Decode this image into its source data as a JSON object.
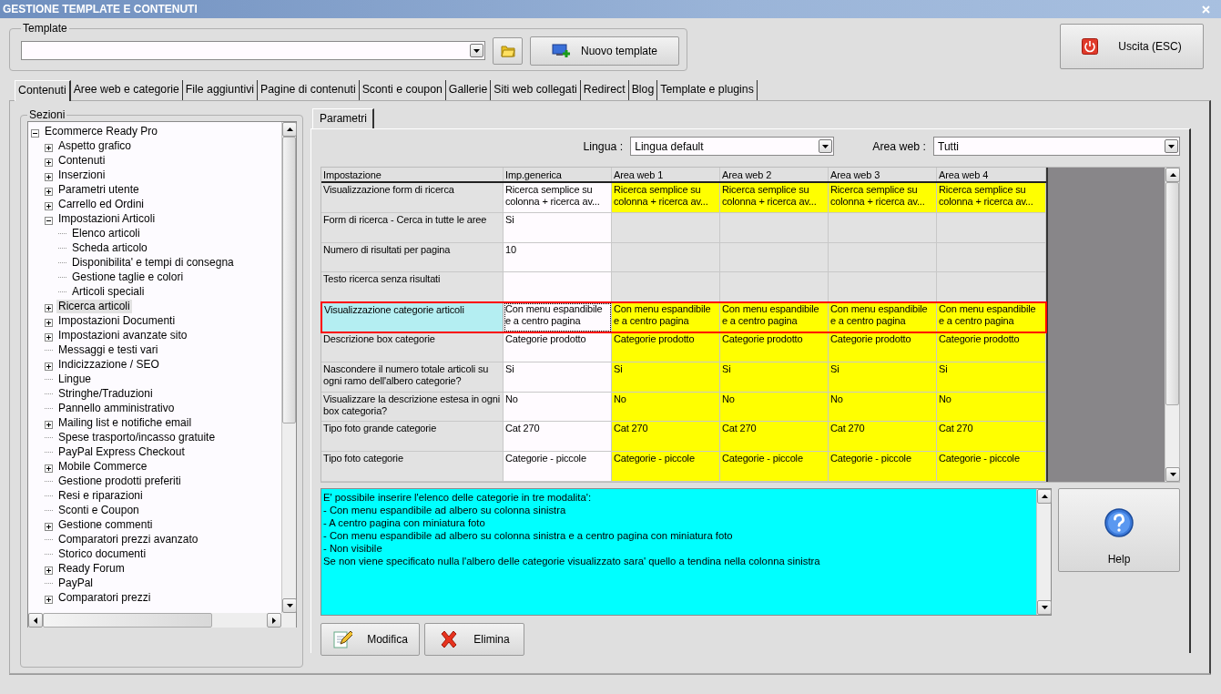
{
  "window": {
    "title": "GESTIONE TEMPLATE E CONTENUTI"
  },
  "template": {
    "label": "Template",
    "new_button": "Nuovo template"
  },
  "exit_button": "Uscita (ESC)",
  "tabs": [
    {
      "label": "Contenuti",
      "selected": true
    },
    {
      "label": "Aree web e categorie",
      "selected": false
    },
    {
      "label": "File aggiuntivi",
      "selected": false
    },
    {
      "label": "Pagine di contenuti",
      "selected": false
    },
    {
      "label": "Sconti e coupon",
      "selected": false
    },
    {
      "label": "Gallerie",
      "selected": false
    },
    {
      "label": "Siti web collegati",
      "selected": false
    },
    {
      "label": "Redirect",
      "selected": false
    },
    {
      "label": "Blog",
      "selected": false
    },
    {
      "label": "Template e plugins",
      "selected": false
    }
  ],
  "sections": {
    "label": "Sezioni",
    "tree": [
      {
        "label": "Ecommerce Ready Pro",
        "expanded": true,
        "selected": false,
        "children": [
          {
            "label": "Aspetto grafico",
            "expanded": false,
            "selected": false
          },
          {
            "label": "Contenuti",
            "expanded": false,
            "selected": false
          },
          {
            "label": "Inserzioni",
            "expanded": false,
            "selected": false
          },
          {
            "label": "Parametri utente",
            "expanded": false,
            "selected": false
          },
          {
            "label": "Carrello ed Ordini",
            "expanded": false,
            "selected": false
          },
          {
            "label": "Impostazioni Articoli",
            "expanded": true,
            "selected": false,
            "children": [
              {
                "label": "Elenco articoli",
                "selected": false
              },
              {
                "label": "Scheda articolo",
                "selected": false
              },
              {
                "label": "Disponibilita' e tempi di consegna",
                "selected": false
              },
              {
                "label": "Gestione taglie e colori",
                "selected": false
              },
              {
                "label": "Articoli speciali",
                "selected": false
              }
            ]
          },
          {
            "label": "Ricerca articoli",
            "expanded": false,
            "selected": true
          },
          {
            "label": "Impostazioni Documenti",
            "expanded": false,
            "selected": false
          },
          {
            "label": "Impostazioni avanzate sito",
            "expanded": false,
            "selected": false
          },
          {
            "label": "Messaggi e testi vari",
            "selected": false
          },
          {
            "label": "Indicizzazione / SEO",
            "expanded": false,
            "selected": false
          },
          {
            "label": "Lingue",
            "selected": false
          },
          {
            "label": "Stringhe/Traduzioni",
            "selected": false
          },
          {
            "label": "Pannello amministrativo",
            "selected": false
          },
          {
            "label": "Mailing list e notifiche email",
            "expanded": false,
            "selected": false
          },
          {
            "label": "Spese trasporto/incasso gratuite",
            "selected": false
          },
          {
            "label": "PayPal Express Checkout",
            "selected": false
          },
          {
            "label": "Mobile Commerce",
            "expanded": false,
            "selected": false
          },
          {
            "label": "Gestione prodotti preferiti",
            "selected": false
          },
          {
            "label": "Resi e riparazioni",
            "selected": false
          },
          {
            "label": "Sconti e Coupon",
            "selected": false
          },
          {
            "label": "Gestione commenti",
            "expanded": false,
            "selected": false
          },
          {
            "label": "Comparatori prezzi avanzato",
            "selected": false
          },
          {
            "label": "Storico documenti",
            "selected": false
          },
          {
            "label": "Ready Forum",
            "expanded": false,
            "selected": false
          },
          {
            "label": "PayPal",
            "selected": false
          },
          {
            "label": "Comparatori prezzi",
            "expanded": false,
            "selected": false
          }
        ]
      }
    ]
  },
  "params": {
    "tabs": [
      {
        "label": "Parametri",
        "selected": true
      }
    ],
    "language": {
      "label": "Lingua :",
      "value": "Lingua default"
    },
    "area": {
      "label": "Area web :",
      "value": "Tutti"
    },
    "table": {
      "columns": [
        "Impostazione",
        "Imp.generica",
        "Area web 1",
        "Area web 2",
        "Area web 3",
        "Area web 4"
      ],
      "rows": [
        {
          "name": "Visualizzazione form di ricerca",
          "generic": "Ricerca semplice su colonna + ricerca av...",
          "selected": false,
          "areas": [
            {
              "value": "Ricerca semplice su colonna + ricerca av...",
              "custom": true
            },
            {
              "value": "Ricerca semplice su colonna + ricerca av...",
              "custom": true
            },
            {
              "value": "Ricerca semplice su colonna + ricerca av...",
              "custom": true
            },
            {
              "value": "Ricerca semplice su colonna + ricerca av...",
              "custom": true
            }
          ]
        },
        {
          "name": "Form di ricerca - Cerca in tutte le aree",
          "generic": "Si",
          "selected": false
        },
        {
          "name": "Numero di risultati per pagina",
          "generic": "10",
          "selected": false
        },
        {
          "name": "Testo ricerca senza risultati",
          "selected": false
        },
        {
          "name": "Visualizzazione categorie articoli",
          "generic": "Con menu espandibile e a centro pagina",
          "selected": true,
          "areas": [
            {
              "value": "Con menu espandibile e a centro pagina",
              "custom": true
            },
            {
              "value": "Con menu espandibile e a centro pagina",
              "custom": true
            },
            {
              "value": "Con menu espandibile e a centro pagina",
              "custom": true
            },
            {
              "value": "Con menu espandibile e a centro pagina",
              "custom": true
            }
          ]
        },
        {
          "name": "Descrizione box categorie",
          "generic": "Categorie prodotto",
          "selected": false,
          "areas": [
            {
              "value": "Categorie prodotto",
              "custom": true
            },
            {
              "value": "Categorie prodotto",
              "custom": true
            },
            {
              "value": "Categorie prodotto",
              "custom": true
            },
            {
              "value": "Categorie prodotto",
              "custom": true
            }
          ]
        },
        {
          "name": "Nascondere il numero totale articoli su ogni ramo dell'albero categorie?",
          "generic": "Si",
          "selected": false,
          "areas": [
            {
              "value": "Si",
              "custom": true
            },
            {
              "value": "Si",
              "custom": true
            },
            {
              "value": "Si",
              "custom": true
            },
            {
              "value": "Si",
              "custom": true
            }
          ]
        },
        {
          "name": "Visualizzare la descrizione estesa in ogni box categoria?",
          "generic": "No",
          "selected": false,
          "areas": [
            {
              "value": "No",
              "custom": true
            },
            {
              "value": "No",
              "custom": true
            },
            {
              "value": "No",
              "custom": true
            },
            {
              "value": "No",
              "custom": true
            }
          ]
        },
        {
          "name": "Tipo foto grande categorie",
          "generic": "Cat 270",
          "selected": false,
          "areas": [
            {
              "value": "Cat 270",
              "custom": true
            },
            {
              "value": "Cat 270",
              "custom": true
            },
            {
              "value": "Cat 270",
              "custom": true
            },
            {
              "value": "Cat 270",
              "custom": true
            }
          ]
        },
        {
          "name": "Tipo foto categorie",
          "generic": "Categorie - piccole",
          "selected": false,
          "areas": [
            {
              "value": "Categorie - piccole",
              "custom": true
            },
            {
              "value": "Categorie - piccole",
              "custom": true
            },
            {
              "value": "Categorie - piccole",
              "custom": true
            },
            {
              "value": "Categorie - piccole",
              "custom": true
            }
          ]
        }
      ]
    },
    "description": "E' possibile inserire l'elenco delle categorie in tre modalita':\n- Con menu espandibile ad albero su colonna sinistra\n- A centro pagina con miniatura foto\n- Con menu espandibile ad albero su colonna sinistra e a centro pagina con miniatura foto\n- Non visibile\nSe non viene specificato nulla l'albero delle categorie visualizzato sara' quello a tendina nella colonna sinistra",
    "help_button": "Help",
    "buttons": [
      {
        "label": "Modifica",
        "kind": "edit"
      },
      {
        "label": "Elimina",
        "kind": "delete"
      }
    ]
  }
}
